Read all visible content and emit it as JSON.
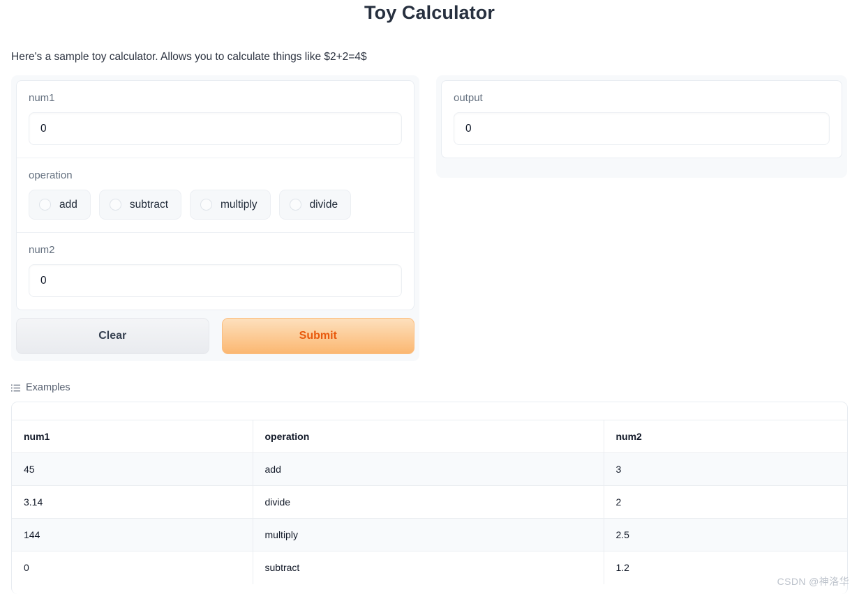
{
  "header": {
    "title": "Toy Calculator",
    "description": "Here's a sample toy calculator. Allows you to calculate things like $2+2=4$"
  },
  "inputs": {
    "num1": {
      "label": "num1",
      "value": "0"
    },
    "operation": {
      "label": "operation",
      "options": [
        "add",
        "subtract",
        "multiply",
        "divide"
      ],
      "selected": ""
    },
    "num2": {
      "label": "num2",
      "value": "0"
    }
  },
  "output": {
    "label": "output",
    "value": "0"
  },
  "buttons": {
    "clear": "Clear",
    "submit": "Submit"
  },
  "examples": {
    "label": "Examples",
    "icon": "list-icon",
    "columns": [
      "num1",
      "operation",
      "num2"
    ],
    "rows": [
      [
        "45",
        "add",
        "3"
      ],
      [
        "3.14",
        "divide",
        "2"
      ],
      [
        "144",
        "multiply",
        "2.5"
      ],
      [
        "0",
        "subtract",
        "1.2"
      ]
    ]
  },
  "watermark": "CSDN @神洛华",
  "colors": {
    "title": "#27303f",
    "submit_text": "#e8590c",
    "submit_bg_top": "#fde0bd",
    "submit_bg_bottom": "#fbb771",
    "panel_bg": "#f7f9fb",
    "label": "#64707f"
  }
}
